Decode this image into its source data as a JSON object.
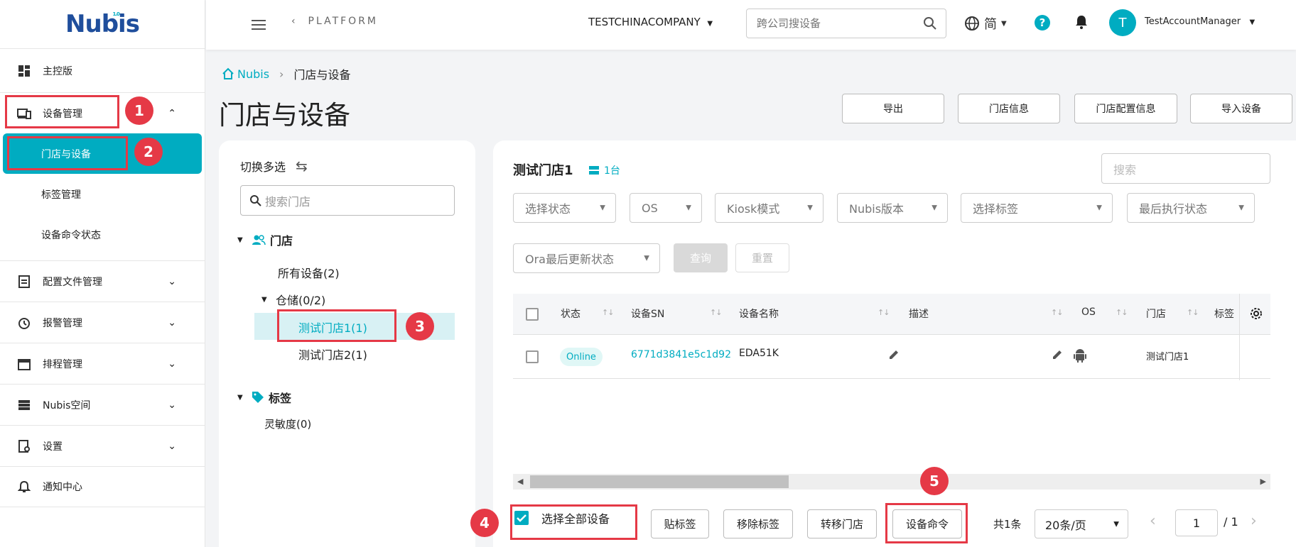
{
  "app": {
    "brand": "Nubis",
    "brand_sup": "1.0",
    "accent": "#00acc1",
    "callout": "#e53946"
  },
  "sidebar": {
    "items": [
      {
        "label": "主控版",
        "icon": "dashboard-icon"
      },
      {
        "label": "设备管理",
        "icon": "devices-icon"
      },
      {
        "label": "配置文件管理",
        "icon": "config-file-icon"
      },
      {
        "label": "报警管理",
        "icon": "alarm-icon"
      },
      {
        "label": "排程管理",
        "icon": "calendar-icon"
      },
      {
        "label": "Nubis空间",
        "icon": "storage-icon"
      },
      {
        "label": "设置",
        "icon": "settings-doc-icon"
      },
      {
        "label": "通知中心",
        "icon": "bell-icon"
      }
    ],
    "sub_items": [
      {
        "label": "门店与设备",
        "active": true
      },
      {
        "label": "标签管理"
      },
      {
        "label": "设备命令状态"
      }
    ]
  },
  "topbar": {
    "platform": "PLATFORM",
    "company": "TESTCHINACOMPANY",
    "search_placeholder": "跨公司搜设备",
    "lang": "简",
    "help": "?",
    "avatar_letter": "T",
    "user": "TestAccountManager"
  },
  "breadcrumb": {
    "home": "Nubis",
    "current": "门店与设备"
  },
  "page": {
    "title": "门店与设备",
    "actions": [
      "导出",
      "门店信息",
      "门店配置信息",
      "导入设备"
    ]
  },
  "tree": {
    "switch_label": "切换多选",
    "search_placeholder": "搜索门店",
    "stores_label": "门店",
    "all_devices": "所有设备(2)",
    "warehouse": "仓储(0/2)",
    "store1": "测试门店1(1)",
    "store2": "测试门店2(1)",
    "tags_label": "标签",
    "tag1": "灵敏度(0)"
  },
  "main": {
    "store_title": "测试门店1",
    "store_count": "1台",
    "search_placeholder": "搜索",
    "filters": [
      "选择状态",
      "OS",
      "Kiosk模式",
      "Nubis版本",
      "选择标签",
      "最后执行状态",
      "Ora最后更新状态"
    ],
    "query_label": "查询",
    "reset_label": "重置",
    "columns": [
      "状态",
      "设备SN",
      "设备名称",
      "描述",
      "OS",
      "门店",
      "标签"
    ],
    "rows": [
      {
        "status": "Online",
        "sn": "6771d3841e5c1d92",
        "name": "EDA51K",
        "store": "测试门店1"
      }
    ]
  },
  "footer": {
    "select_all": "选择全部设备",
    "actions": [
      "贴标签",
      "移除标签",
      "转移门店",
      "设备命令"
    ],
    "total": "共1条",
    "page_size": "20条/页",
    "page": "1",
    "page_total": "/ 1"
  },
  "callouts": [
    "1",
    "2",
    "3",
    "4",
    "5"
  ]
}
